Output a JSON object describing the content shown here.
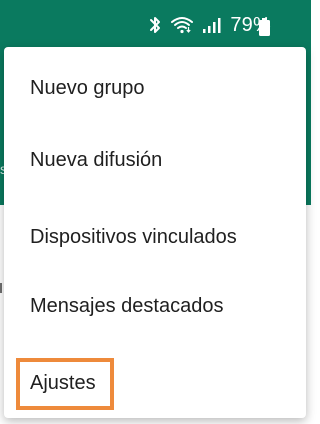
{
  "status_bar": {
    "battery_text": "79%",
    "icons": [
      "bluetooth-icon",
      "wifi-icon",
      "signal-icon",
      "battery-icon"
    ]
  },
  "menu": {
    "items": [
      {
        "label": "Nuevo grupo"
      },
      {
        "label": "Nueva difusión"
      },
      {
        "label": "Dispositivos vinculados"
      },
      {
        "label": "Mensajes destacados"
      },
      {
        "label": "Ajustes"
      }
    ]
  },
  "colors": {
    "header_green": "#0a7a5f",
    "highlight": "#ee8a3b",
    "menu_text": "#1f1f1f",
    "status_text": "#ffffff"
  },
  "header": {
    "edge_text": "s"
  }
}
